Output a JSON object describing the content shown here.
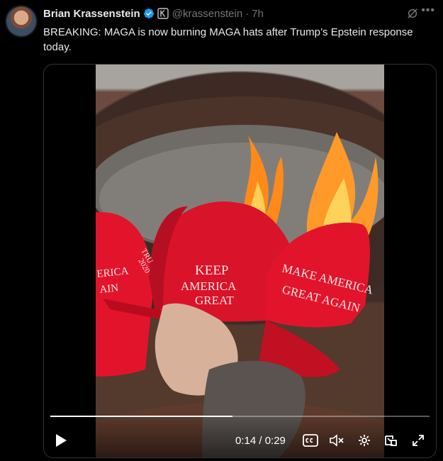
{
  "author": {
    "name": "Brian Krassenstein",
    "handle": "@krassenstein",
    "separator": "·",
    "time": "7h"
  },
  "tweet": {
    "text": "BREAKING:  MAGA is now burning MAGA hats after Trump’s Epstein response today."
  },
  "media": {
    "hat_text": {
      "left": [
        "ERICA",
        "AIN"
      ],
      "center": [
        "KEEP",
        "AMERICA",
        "GREAT"
      ],
      "right": [
        "MAKE AMERICA",
        "GREAT AGAIN"
      ],
      "side": [
        "TRU",
        "2020"
      ]
    },
    "player": {
      "timecode": "0:14 / 0:29",
      "progress": 0.48
    }
  },
  "colors": {
    "background": "#000000",
    "text": "#e7e9ea",
    "muted": "#71767b",
    "verified": "#1d9bf0",
    "hat_red": "#e2142b",
    "flame_orange": "#ff8a1a"
  },
  "icons": [
    "verified-badge-icon",
    "affiliate-icon",
    "grok-icon",
    "more-icon",
    "play-icon",
    "captions-icon",
    "mute-icon",
    "settings-icon",
    "pip-icon",
    "fullscreen-icon"
  ]
}
